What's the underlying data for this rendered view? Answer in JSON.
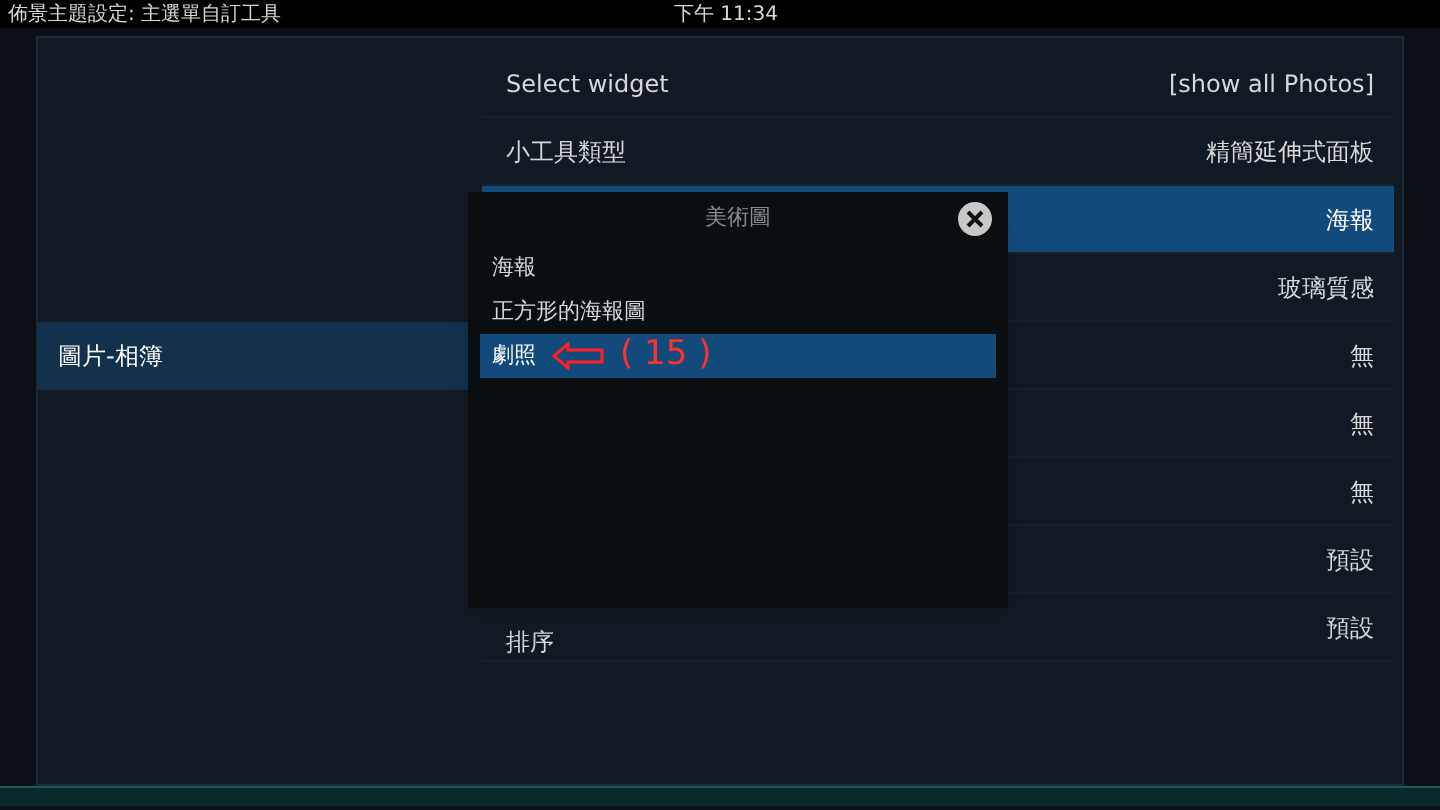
{
  "top_bar": {
    "title": "佈景主題設定: 主選單自訂工具",
    "clock": "下午 11:34"
  },
  "categories": [
    {
      "label": "圖片-相簿",
      "selected": true
    }
  ],
  "settings": [
    {
      "label": "Select widget",
      "value": "[show all Photos]",
      "selected": false
    },
    {
      "label": "小工具類型",
      "value": "精簡延伸式面板",
      "selected": false
    },
    {
      "value": "海報",
      "selected": true
    },
    {
      "value": "玻璃質感",
      "selected": false
    },
    {
      "value": "無",
      "selected": false
    },
    {
      "value": "無",
      "selected": false
    },
    {
      "value": "無",
      "selected": false
    },
    {
      "value": "預設",
      "selected": false
    },
    {
      "label": "排序",
      "value": "預設",
      "selected": false
    }
  ],
  "dialog": {
    "title": "美術圖",
    "options": [
      {
        "label": "海報",
        "selected": false
      },
      {
        "label": "正方形的海報圖",
        "selected": false
      },
      {
        "label": "劇照",
        "selected": true,
        "annotation": "( 15 )"
      }
    ]
  }
}
